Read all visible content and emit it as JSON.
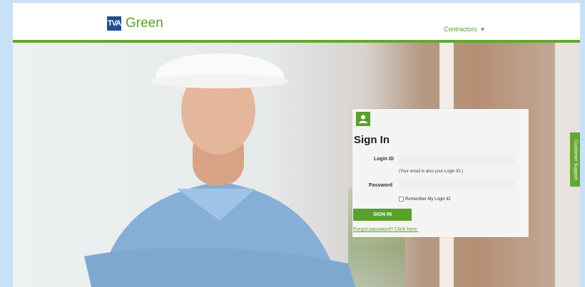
{
  "header": {
    "logo_mark": "TVA",
    "logo_text": "Green",
    "nav_label": "Contractors",
    "nav_icon": "chevron-down-icon"
  },
  "login": {
    "title": "Sign In",
    "login_id_label": "Login ID",
    "login_id_value": "",
    "login_id_hint": "(Your email is also your Login ID.)",
    "password_label": "Password",
    "password_value": "",
    "remember_label": "Remember My Login ID",
    "submit_label": "SIGN IN",
    "forgot_link": "Forgot password? Click here."
  },
  "side_tab": {
    "label": "Customer Support"
  },
  "colors": {
    "brand_green": "#5aa02c",
    "logo_blue": "#1f4e8c"
  }
}
